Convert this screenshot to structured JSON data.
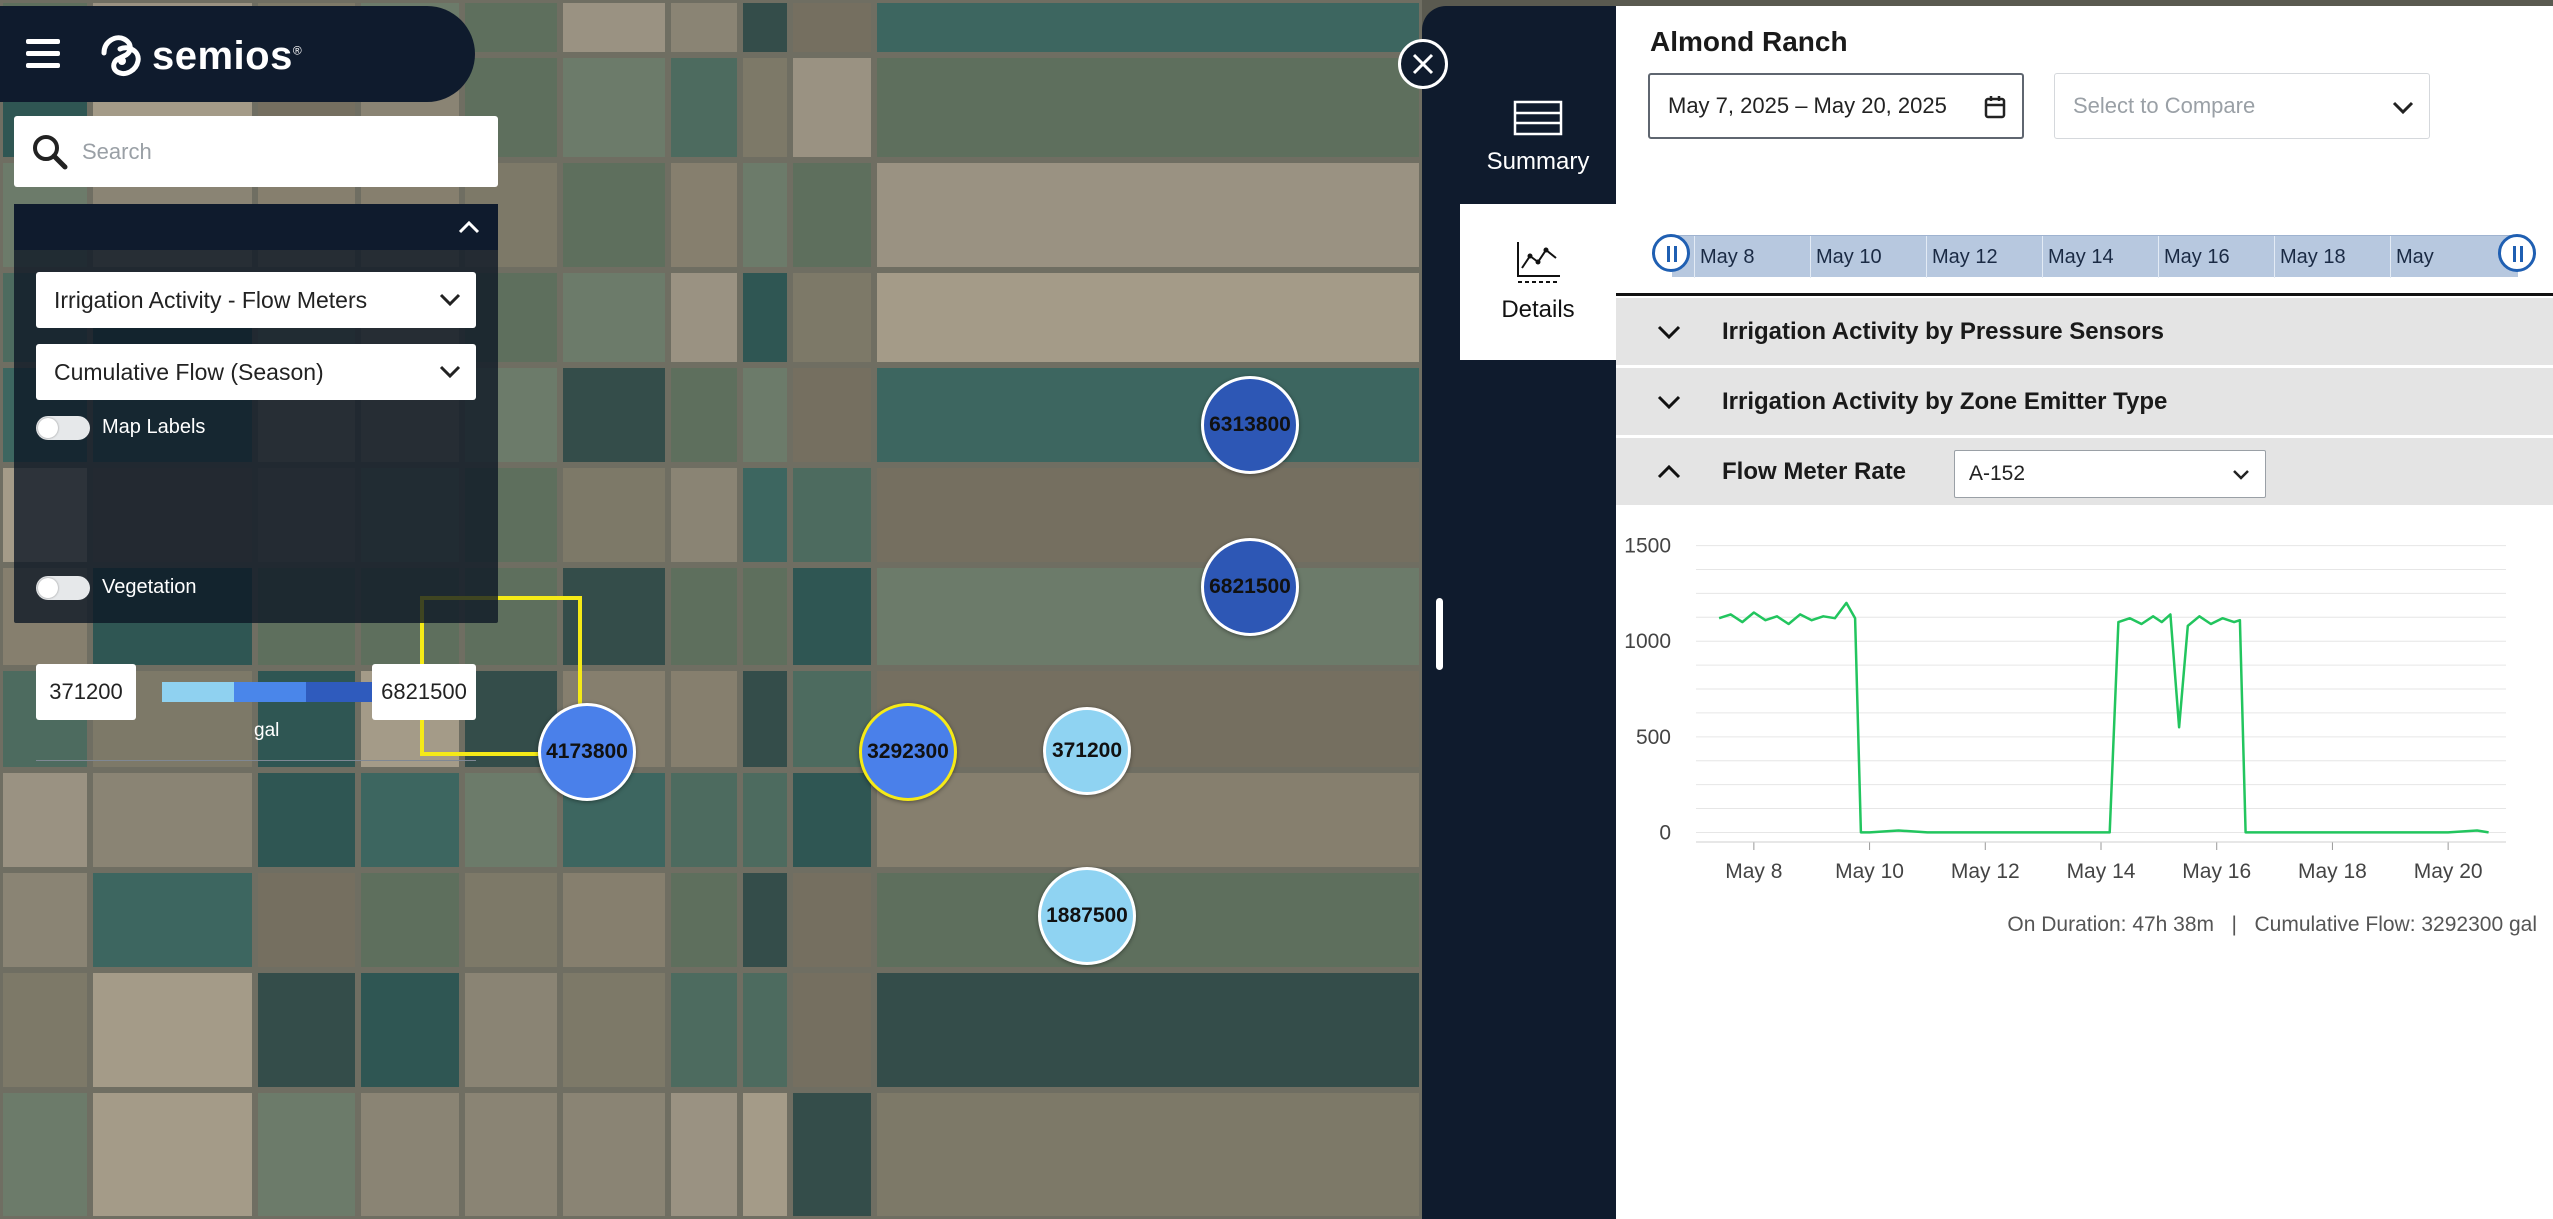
{
  "header": {
    "brand": "semios",
    "brand_mark": "®"
  },
  "search": {
    "placeholder": "Search"
  },
  "layer_panel": {
    "layer_select": "Irrigation Activity - Flow Meters",
    "metric_select": "Cumulative Flow (Season)",
    "map_labels_label": "Map Labels",
    "legend_min": "371200",
    "legend_max": "6821500",
    "legend_unit": "gal",
    "legend_colors": [
      "#8fd1f0",
      "#4a86ea",
      "#2f5bbd"
    ],
    "vegetation_label": "Vegetation"
  },
  "markers": [
    {
      "label": "6313800",
      "color": "#2d57b5"
    },
    {
      "label": "6821500",
      "color": "#2d57b5"
    },
    {
      "label": "4173800",
      "color": "#4a80ea"
    },
    {
      "label": "3292300",
      "color": "#4a80ea",
      "border": "#f5ea17"
    },
    {
      "label": "371200",
      "color": "#8fd3f2"
    },
    {
      "label": "1887500",
      "color": "#8fd3f2"
    }
  ],
  "nav": {
    "summary_label": "Summary",
    "details_label": "Details"
  },
  "details": {
    "ranch_name": "Almond Ranch",
    "date_range": "May 7, 2025 – May 20, 2025",
    "compare_placeholder": "Select to Compare",
    "timeline_labels": [
      "May 8",
      "May 10",
      "May 12",
      "May 14",
      "May 16",
      "May 18",
      "May"
    ],
    "accordions": [
      {
        "title": "Irrigation Activity by Pressure Sensors",
        "expanded": false
      },
      {
        "title": "Irrigation Activity by Zone Emitter Type",
        "expanded": false
      },
      {
        "title": "Flow Meter Rate",
        "expanded": true
      }
    ],
    "meter_select": "A-152",
    "summary_text": "On Duration: 47h 38m   |   Cumulative Flow: 3292300 gal"
  },
  "chart_data": {
    "type": "line",
    "title": "",
    "xlabel": "",
    "ylabel": "",
    "ylim": [
      -50,
      1550
    ],
    "y_ticks": [
      "1500",
      "1000",
      "500",
      "0"
    ],
    "x_ticks": [
      "May 8",
      "May 10",
      "May 12",
      "May 14",
      "May 16",
      "May 18",
      "May 20"
    ],
    "xlim": [
      "May 7",
      "May 21"
    ],
    "grid": true,
    "series": [
      {
        "color": "#22c55e",
        "x": [
          "May 7.4",
          "May 7.6",
          "May 7.8",
          "May 8",
          "May 8.2",
          "May 8.4",
          "May 8.6",
          "May 8.8",
          "May 9",
          "May 9.2",
          "May 9.4",
          "May 9.6",
          "May 9.75",
          "May 9.85",
          "May 10",
          "May 10.5",
          "May 11",
          "May 12",
          "May 13",
          "May 14",
          "May 14.15",
          "May 14.3",
          "May 14.5",
          "May 14.7",
          "May 14.9",
          "May 15.05",
          "May 15.2",
          "May 15.35",
          "May 15.5",
          "May 15.7",
          "May 15.9",
          "May 16.1",
          "May 16.3",
          "May 16.4",
          "May 16.5",
          "May 17",
          "May 18",
          "May 19",
          "May 20",
          "May 20.5",
          "May 20.7"
        ],
        "y": [
          1120,
          1140,
          1100,
          1150,
          1110,
          1130,
          1090,
          1140,
          1110,
          1130,
          1120,
          1200,
          1120,
          0,
          0,
          10,
          0,
          0,
          0,
          0,
          0,
          1100,
          1120,
          1090,
          1130,
          1100,
          1140,
          550,
          1080,
          1130,
          1090,
          1120,
          1100,
          1110,
          0,
          0,
          0,
          0,
          0,
          10,
          0
        ]
      }
    ]
  }
}
